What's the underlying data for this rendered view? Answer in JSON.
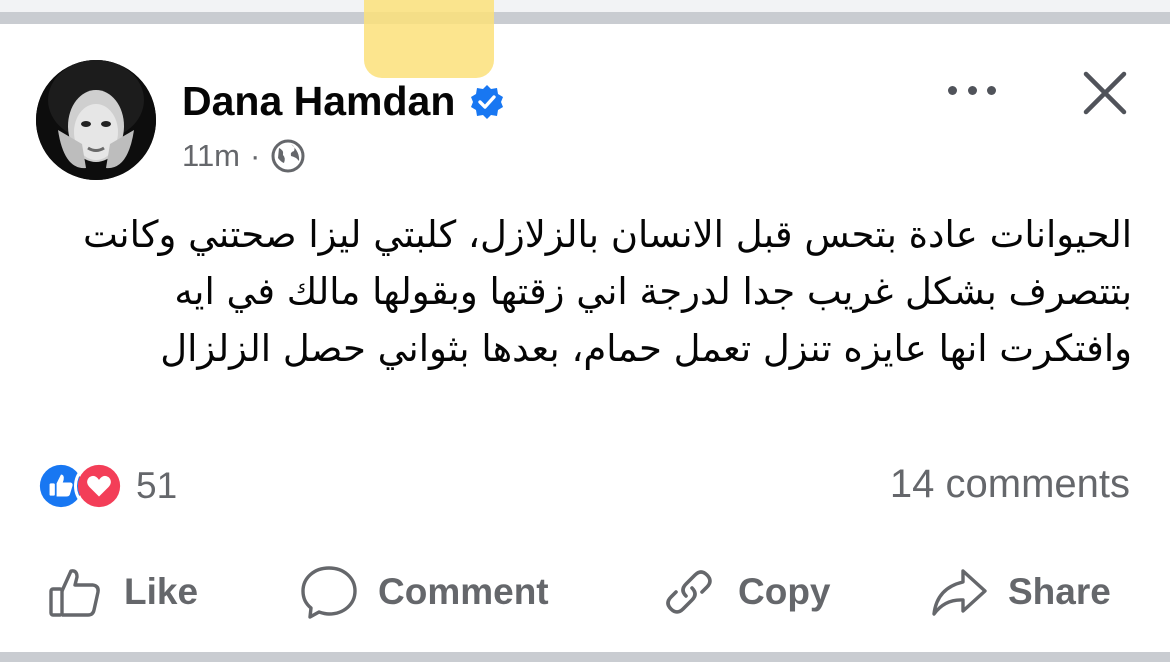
{
  "post": {
    "author": "Dana Hamdan",
    "time": "11m",
    "separator": "·",
    "text": "الحيوانات عادة بتحس قبل الانسان بالزلازل، كلبتي ليزا صحتني وكانت بتتصرف بشكل غريب جدا لدرجة اني زقتها وبقولها مالك في ايه وافتكرت انها عايزه تنزل تعمل حمام، بعدها بثواني حصل الزلزال"
  },
  "icons": {
    "verified": "verified-badge-icon",
    "audience": "globe-icon",
    "more": "more-options-icon",
    "close": "close-icon",
    "reaction_like": "like-reaction-icon",
    "reaction_love": "love-reaction-icon"
  },
  "stats": {
    "reactions_count": "51",
    "comments": "14 comments"
  },
  "actions": {
    "like": "Like",
    "comment": "Comment",
    "copy": "Copy",
    "share": "Share"
  },
  "colors": {
    "verified_blue": "#1877f2",
    "like_blue": "#1877f2",
    "love_red": "#f33e58",
    "secondary_text": "#65676b"
  }
}
